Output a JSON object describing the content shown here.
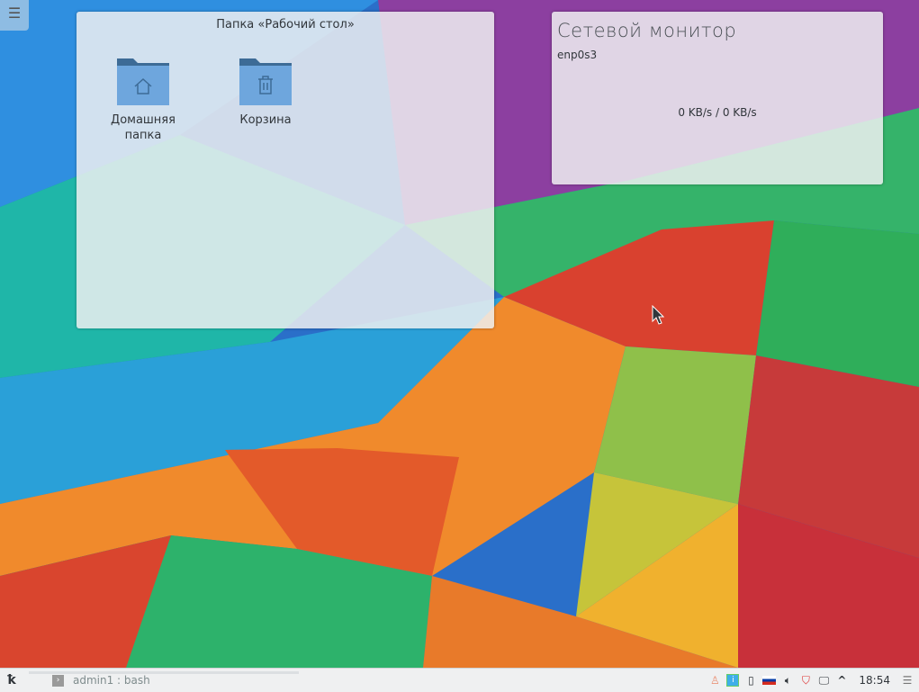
{
  "desktop_toolbox": {
    "icon": "hamburger-icon",
    "glyph": "☰"
  },
  "folder_view": {
    "title": "Папка «Рабочий стол»",
    "items": [
      {
        "label": "Домашняя папка",
        "icon": "folder-home-icon"
      },
      {
        "label": "Корзина",
        "icon": "folder-trash-icon"
      }
    ]
  },
  "network_monitor": {
    "title": "Сетевой монитор",
    "interface": "enp0s3",
    "rate": "0 KB/s / 0 KB/s"
  },
  "panel": {
    "launcher_icon": "kde-logo-icon",
    "task": {
      "label": "admin1 : bash",
      "icon": "terminal-icon"
    },
    "tray": {
      "chevron": "^",
      "clock": "18:54",
      "menu": "☰"
    },
    "colors": {
      "panel_bg": "#eff0f1",
      "accent": "#3daee9"
    }
  }
}
